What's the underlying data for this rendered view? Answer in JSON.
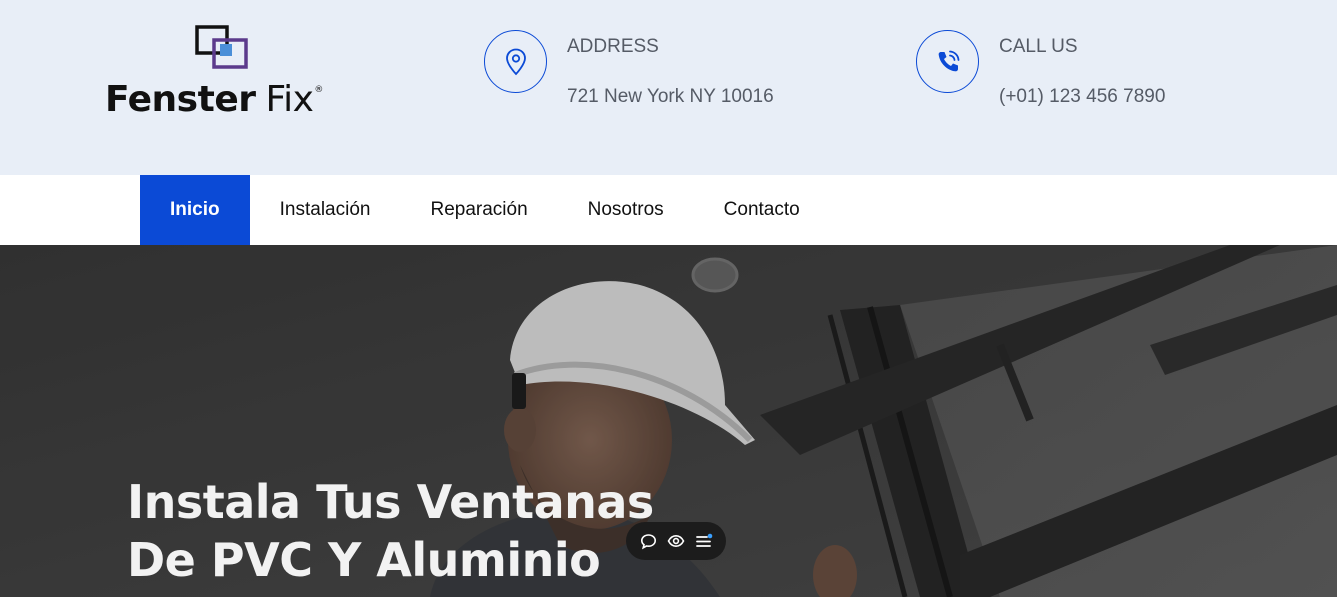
{
  "brand": {
    "name_bold": "Fenster",
    "name_light": "Fix",
    "registered": "®",
    "accent_color": "#0b4ad6",
    "logo_purple": "#5b3a8c"
  },
  "contact": {
    "address": {
      "icon": "location-pin-icon",
      "label": "ADDRESS",
      "value": "721 New York NY 10016"
    },
    "call": {
      "icon": "phone-icon",
      "label": "CALL US",
      "value": "(+01) 123 456 7890"
    }
  },
  "nav": {
    "items": [
      {
        "label": "Inicio",
        "active": true
      },
      {
        "label": "Instalación",
        "active": false
      },
      {
        "label": "Reparación",
        "active": false
      },
      {
        "label": "Nosotros",
        "active": false
      },
      {
        "label": "Contacto",
        "active": false
      }
    ]
  },
  "hero": {
    "title_line1": "Instala Tus Ventanas",
    "title_line2": "De PVC Y Aluminio"
  },
  "floating_toolbar": {
    "buttons": [
      "comment-icon",
      "eye-icon",
      "menu-list-icon"
    ]
  },
  "colors": {
    "topbar_bg": "#e8eef7",
    "nav_active_bg": "#0b4ad6",
    "text_muted": "#555b66"
  }
}
